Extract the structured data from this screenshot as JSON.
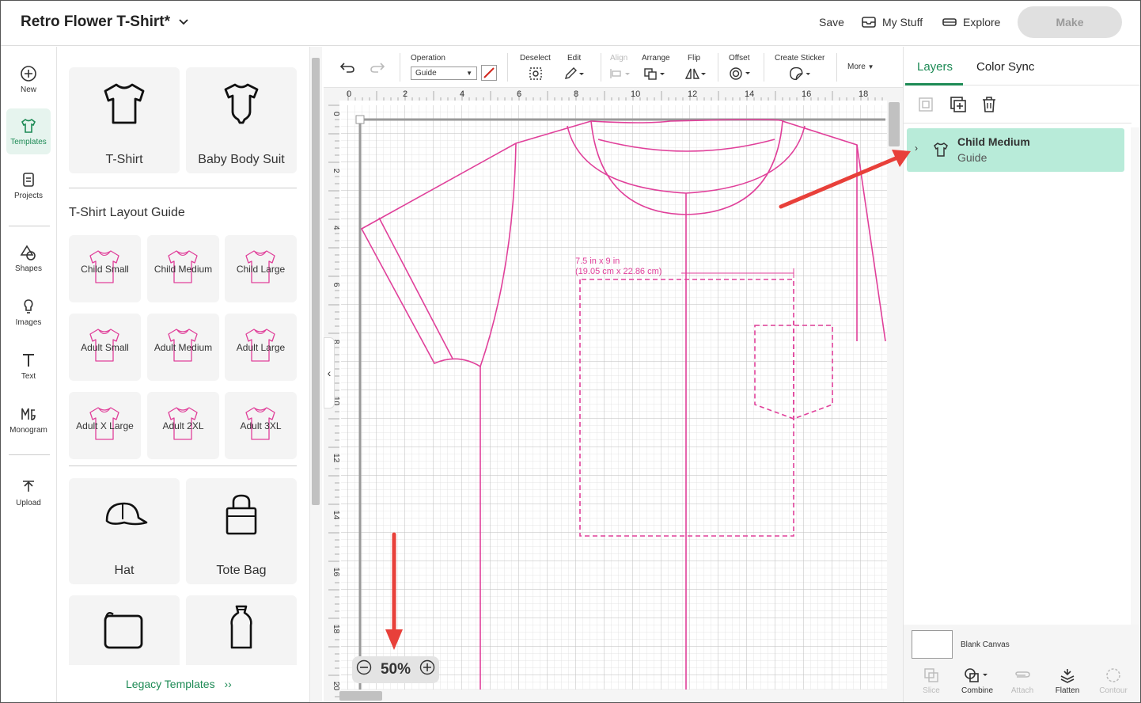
{
  "header": {
    "title": "Retro Flower T-Shirt*",
    "save_label": "Save",
    "mystuff_label": "My Stuff",
    "explore_label": "Explore",
    "make_label": "Make"
  },
  "leftnav": {
    "new": "New",
    "templates": "Templates",
    "projects": "Projects",
    "shapes": "Shapes",
    "images": "Images",
    "text": "Text",
    "monogram": "Monogram",
    "upload": "Upload"
  },
  "templates": {
    "tshirt": "T-Shirt",
    "babybodysuit": "Baby Body Suit",
    "layout_title": "T-Shirt Layout Guide",
    "sizes": [
      "Child Small",
      "Child Medium",
      "Child Large",
      "Adult Small",
      "Adult Medium",
      "Adult Large",
      "Adult X Large",
      "Adult 2XL",
      "Adult 3XL"
    ],
    "hat": "Hat",
    "totebag": "Tote Bag",
    "legacy": "Legacy Templates"
  },
  "toolbar": {
    "operation": "Operation",
    "operation_value": "Guide",
    "deselect": "Deselect",
    "edit": "Edit",
    "align": "Align",
    "arrange": "Arrange",
    "flip": "Flip",
    "offset": "Offset",
    "create_sticker": "Create Sticker",
    "more": "More"
  },
  "canvas": {
    "ruler_top": [
      "0",
      "2",
      "4",
      "6",
      "8",
      "10",
      "12",
      "14",
      "16",
      "18"
    ],
    "ruler_left": [
      "0",
      "2",
      "4",
      "6",
      "8",
      "10",
      "12",
      "14",
      "16",
      "18",
      "20"
    ],
    "dim_line1": "7.5 in x 9 in",
    "dim_line2": "(19.05 cm x 22.86 cm)",
    "zoom": "50%"
  },
  "layers": {
    "tab_layers": "Layers",
    "tab_colorsync": "Color Sync",
    "layer_name": "Child Medium",
    "layer_type": "Guide",
    "blank_canvas": "Blank Canvas",
    "slice": "Slice",
    "combine": "Combine",
    "attach": "Attach",
    "flatten": "Flatten",
    "contour": "Contour"
  },
  "colors": {
    "accent": "#1d8a55",
    "guide": "#e0409a",
    "layer_selected": "#b8ebd9",
    "annotation_arrow": "#e8403a"
  }
}
